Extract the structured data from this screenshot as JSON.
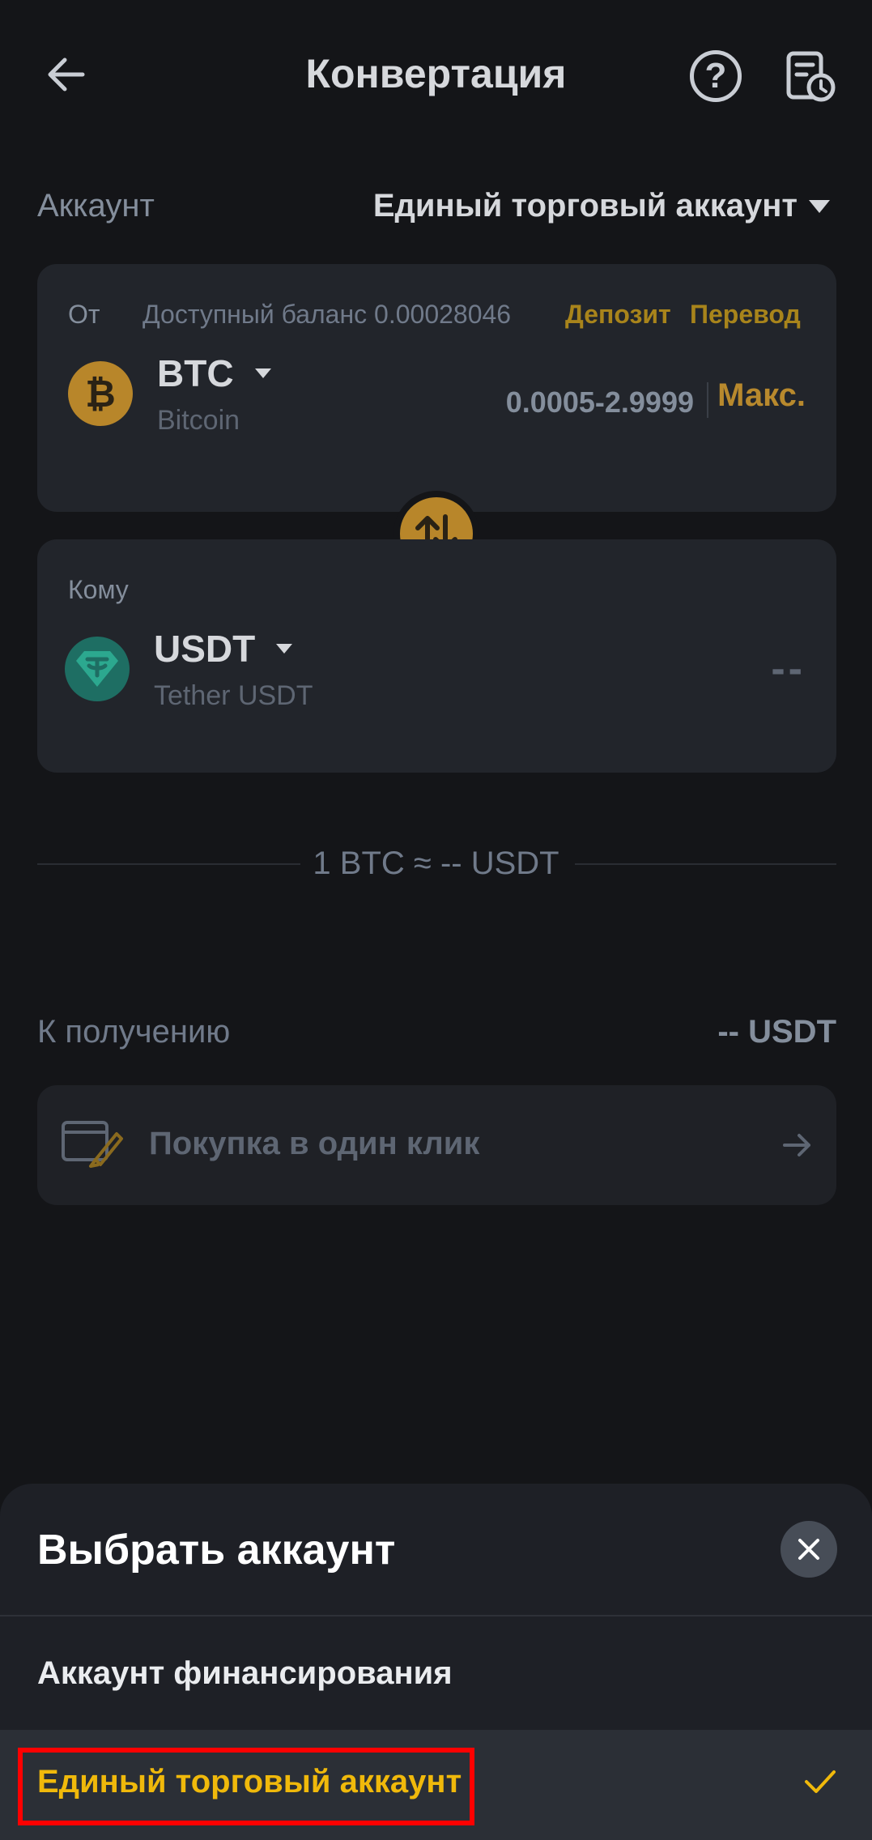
{
  "header": {
    "title": "Конвертация"
  },
  "account": {
    "label": "Аккаунт",
    "value": "Единый торговый аккаунт"
  },
  "from": {
    "label": "От",
    "available": "Доступный баланс 0.00028046",
    "deposit": "Депозит",
    "transfer": "Перевод",
    "coin_code": "BTC",
    "coin_name": "Bitcoin",
    "range": "0.0005-2.9999",
    "max": "Макс."
  },
  "to": {
    "label": "Кому",
    "coin_code": "USDT",
    "coin_name": "Tether USDT",
    "amount": "--"
  },
  "rate": "1 BTC ≈ -- USDT",
  "receive": {
    "label": "К получению",
    "value": "-- USDT"
  },
  "one_click": {
    "label": "Покупка в один клик"
  },
  "sheet": {
    "title": "Выбрать аккаунт",
    "options": [
      {
        "label": "Аккаунт финансирования",
        "selected": false
      },
      {
        "label": "Единый торговый аккаунт",
        "selected": true
      }
    ]
  },
  "colors": {
    "accent": "#F0B90B",
    "bg": "#141518",
    "card": "#22252B",
    "highlight": "#FF0000"
  }
}
